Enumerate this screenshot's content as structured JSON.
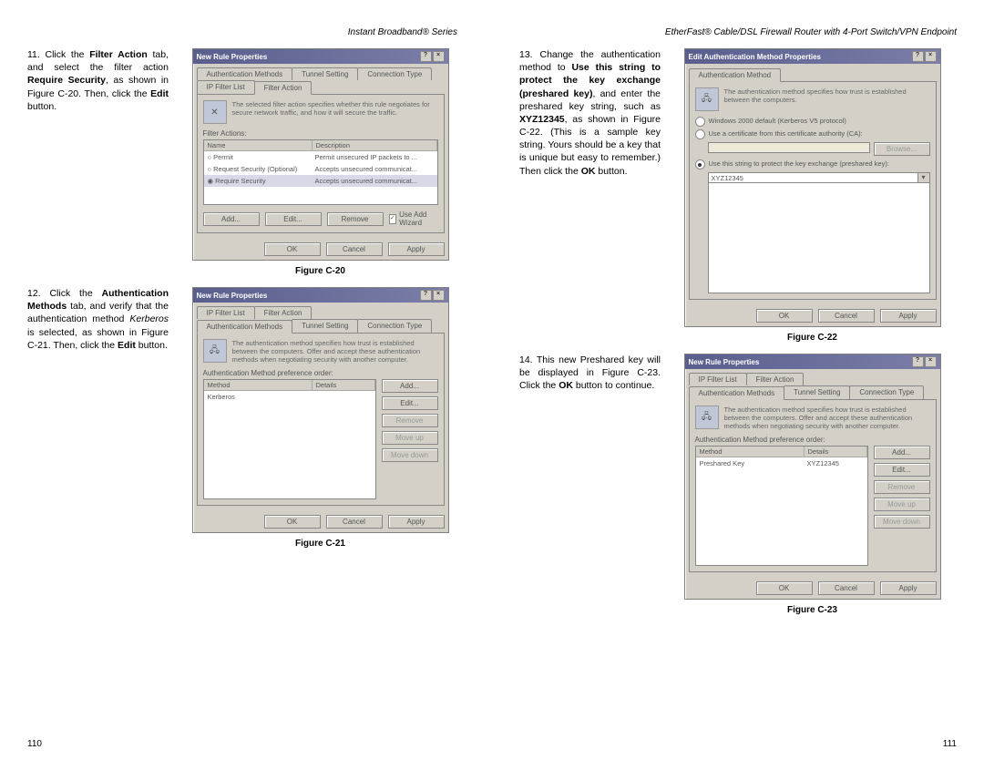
{
  "leftHeader": "Instant Broadband® Series",
  "rightHeader": "EtherFast® Cable/DSL Firewall Router with 4-Port Switch/VPN Endpoint",
  "leftPageNum": "110",
  "rightPageNum": "111",
  "step11": {
    "num": "11.",
    "pre": "Click the ",
    "b1": "Filter Action",
    "mid1": " tab, and select the filter action ",
    "b2": "Require Security",
    "mid2": ", as shown in Figure C-20. Then, click the ",
    "b3": "Edit",
    "end": " button."
  },
  "step12": {
    "num": "12.",
    "pre": "Click the ",
    "b1": "Authentication Methods",
    "mid1": " tab, and verify that the authentication method ",
    "i1": "Kerberos",
    "mid2": " is selected, as shown in Figure C-21. Then, click the ",
    "b2": "Edit",
    "end": " button."
  },
  "step13": {
    "num": "13.",
    "pre": "Change the authentication method to ",
    "b1": "Use this string to protect the key exchange (preshared key)",
    "mid1": ", and enter the preshared key string, such as ",
    "b2": "XYZ12345",
    "mid2": ", as shown in Figure C-22. (This is a sample key string. Yours should be a key that is unique but easy to remember.) Then click the ",
    "b3": "OK",
    "end": " button."
  },
  "step14": {
    "num": "14.",
    "pre": "This new Preshared key will be displayed in Figure C-23. Click the ",
    "b1": "OK",
    "end": " button to continue."
  },
  "captions": {
    "c20": "Figure C-20",
    "c21": "Figure C-21",
    "c22": "Figure C-22",
    "c23": "Figure C-23"
  },
  "dlg20": {
    "title": "New Rule Properties",
    "help": "?",
    "close": "×",
    "tabs": {
      "am": "Authentication Methods",
      "ts": "Tunnel Setting",
      "ct": "Connection Type",
      "ifl": "IP Filter List",
      "fa": "Filter Action"
    },
    "info": "The selected filter action specifies whether this rule negotiates for secure network traffic, and how it will secure the traffic.",
    "listLabel": "Filter Actions:",
    "hdrA": "Name",
    "hdrB": "Description",
    "rows": [
      {
        "a": "Permit",
        "b": "Permit unsecured IP packets to ..."
      },
      {
        "a": "Request Security (Optional)",
        "b": "Accepts unsecured communicat..."
      },
      {
        "a": "Require Security",
        "b": "Accepts unsecured communicat..."
      }
    ],
    "add": "Add...",
    "edit": "Edit...",
    "remove": "Remove",
    "wiz": "Use Add Wizard",
    "ok": "OK",
    "cancel": "Cancel",
    "apply": "Apply"
  },
  "dlg21": {
    "title": "New Rule Properties",
    "tabs": {
      "ifl": "IP Filter List",
      "fa": "Filter Action",
      "am": "Authentication Methods",
      "ts": "Tunnel Setting",
      "ct": "Connection Type"
    },
    "info": "The authentication method specifies how trust is established between the computers. Offer and accept these authentication methods when negotiating security with another computer.",
    "listLabel": "Authentication Method preference order:",
    "hdrA": "Method",
    "hdrB": "Details",
    "rowA": "Kerberos",
    "rowB": "",
    "add": "Add...",
    "edit": "Edit...",
    "remove": "Remove",
    "moveup": "Move up",
    "movedown": "Move down",
    "ok": "OK",
    "cancel": "Cancel",
    "apply": "Apply"
  },
  "dlg22": {
    "title": "Edit Authentication Method Properties",
    "tab": "Authentication Method",
    "info": "The authentication method specifies how trust is established between the computers.",
    "opt1": "Windows 2000 default (Kerberos V5 protocol)",
    "opt2": "Use a certificate from this certificate authority (CA):",
    "browse": "Browse...",
    "opt3": "Use this string to protect the key exchange (preshared key):",
    "key": "XYZ12345",
    "ok": "OK",
    "cancel": "Cancel",
    "apply": "Apply"
  },
  "dlg23": {
    "title": "New Rule Properties",
    "tabs": {
      "ifl": "IP Filter List",
      "fa": "Filter Action",
      "am": "Authentication Methods",
      "ts": "Tunnel Setting",
      "ct": "Connection Type"
    },
    "info": "The authentication method specifies how trust is established between the computers. Offer and accept these authentication methods when negotiating security with another computer.",
    "listLabel": "Authentication Method preference order:",
    "hdrA": "Method",
    "hdrB": "Details",
    "rowA": "Preshared Key",
    "rowB": "XYZ12345",
    "add": "Add...",
    "edit": "Edit...",
    "remove": "Remove",
    "moveup": "Move up",
    "movedown": "Move down",
    "ok": "OK",
    "cancel": "Cancel",
    "apply": "Apply"
  }
}
